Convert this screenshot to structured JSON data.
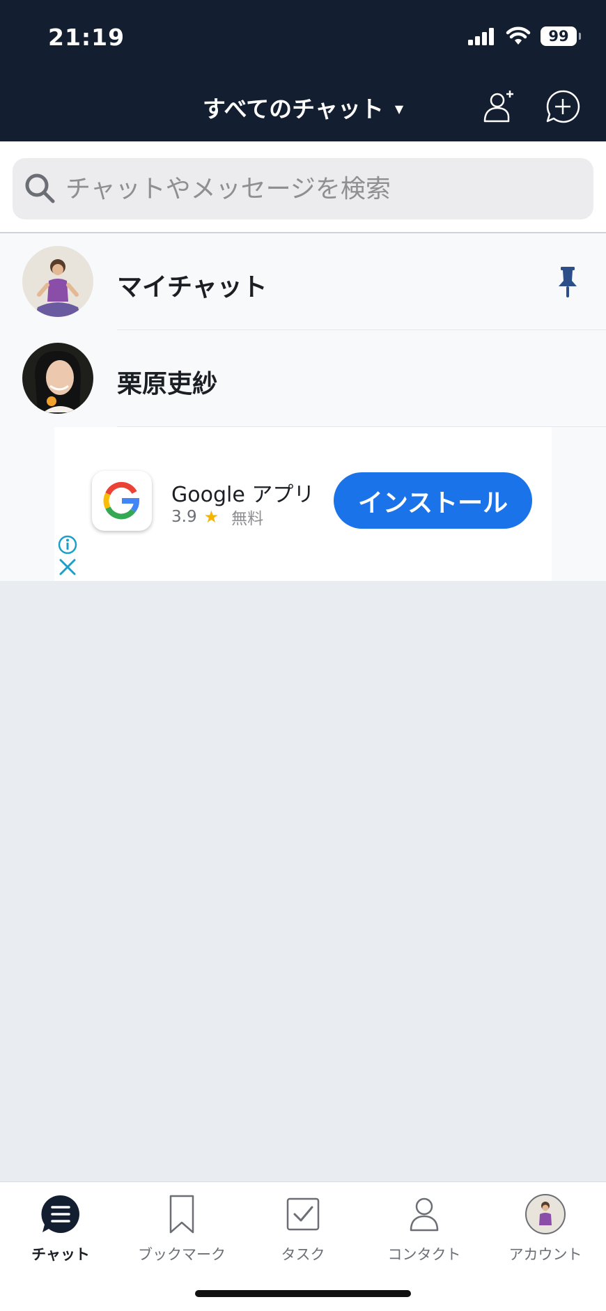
{
  "status_bar": {
    "time": "21:19",
    "battery": "99"
  },
  "header": {
    "title": "すべてのチャット"
  },
  "search": {
    "placeholder": "チャットやメッセージを検索"
  },
  "chats": [
    {
      "name": "マイチャット",
      "pinned": true
    },
    {
      "name": "栗原吏紗",
      "pinned": false
    }
  ],
  "ad": {
    "app_name": "Google アプリ",
    "rating": "3.9",
    "price": "無料",
    "install_label": "インストール"
  },
  "tabs": [
    {
      "label": "チャット",
      "icon": "chat-menu-icon",
      "active": true
    },
    {
      "label": "ブックマーク",
      "icon": "bookmark-icon",
      "active": false
    },
    {
      "label": "タスク",
      "icon": "task-check-icon",
      "active": false
    },
    {
      "label": "コンタクト",
      "icon": "contact-person-icon",
      "active": false
    },
    {
      "label": "アカウント",
      "icon": "account-avatar",
      "active": false
    }
  ],
  "colors": {
    "header_bg": "#131e30",
    "accent": "#1a73e8",
    "pin": "#2c4f8a"
  }
}
